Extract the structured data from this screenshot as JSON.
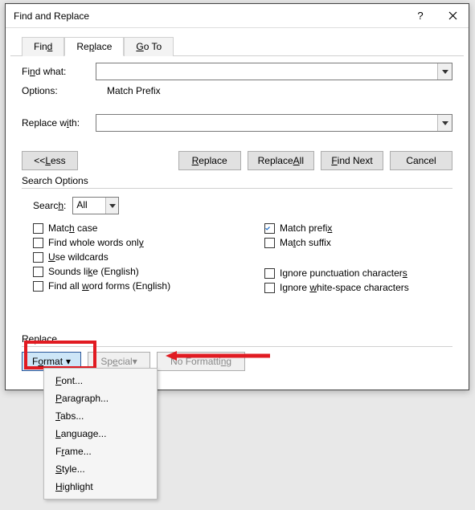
{
  "titlebar": {
    "title": "Find and Replace"
  },
  "tabs": {
    "find": "Find",
    "replace": "Replace",
    "goto": "Go To"
  },
  "findwhat_label": "Find what:",
  "options_label": "Options:",
  "options_value": "Match Prefix",
  "replacewith_label": "Replace with:",
  "buttons": {
    "less": "<< Less",
    "replace": "Replace",
    "replaceall": "Replace All",
    "findnext": "Find Next",
    "cancel": "Cancel"
  },
  "search_options_head": "Search Options",
  "search_label": "Search:",
  "search_direction": "All",
  "checks_left": [
    "Match case",
    "Find whole words only",
    "Use wildcards",
    "Sounds like (English)",
    "Find all word forms (English)"
  ],
  "checks_right": [
    {
      "label": "Match prefix",
      "checked": true
    },
    {
      "label": "Match suffix",
      "checked": false
    },
    {
      "label": "Ignore punctuation characters",
      "checked": false
    },
    {
      "label": "Ignore white-space characters",
      "checked": false
    }
  ],
  "replace_head": "Replace",
  "format_btn": "Format",
  "special_btn": "Special",
  "noformat_btn": "No Formatting",
  "menu": [
    "Font...",
    "Paragraph...",
    "Tabs...",
    "Language...",
    "Frame...",
    "Style...",
    "Highlight"
  ]
}
